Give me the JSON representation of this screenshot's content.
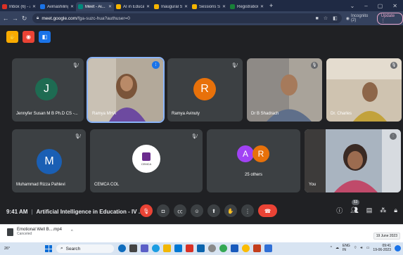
{
  "browser": {
    "tabs": [
      {
        "title": "Inbox (6) - aa...",
        "color": "#d93025",
        "active": false
      },
      {
        "title": "Avinashilingam",
        "color": "#1a73e8",
        "active": false
      },
      {
        "title": "Meet - Ai...",
        "color": "#00897b",
        "active": true
      },
      {
        "title": "AI in Education",
        "color": "#f4b400",
        "active": false
      },
      {
        "title": "Inaugural Sess",
        "color": "#f4b400",
        "active": false
      },
      {
        "title": "Sessions Slide",
        "color": "#f4b400",
        "active": false
      },
      {
        "title": "Registration fo",
        "color": "#188038",
        "active": false
      }
    ],
    "new_tab": "+",
    "url_host": "meet.google.com",
    "url_path": "/fga-suzc-hua?authuser=0",
    "incognito_label": "Incognito (2)",
    "update_label": "Update"
  },
  "meet": {
    "tiles": [
      {
        "name": "Jennyfer Susan M B Ph.D CS -...",
        "initial": "J",
        "avatar_color": "#1e6b52",
        "muted": true
      },
      {
        "name": "Ramya MHA",
        "photo": true,
        "speaking": true
      },
      {
        "name": "Ramya Avinuty",
        "initial": "R",
        "avatar_color": "#e8710a",
        "muted": true
      },
      {
        "name": "Dr B Shadrach",
        "photo": true
      },
      {
        "name": "Dr. Charles",
        "photo": true
      },
      {
        "name": "Muhammad Rizza Pahlevi",
        "initial": "M",
        "avatar_color": "#1a5fb4",
        "muted": true
      },
      {
        "name": "CEMCA COL",
        "logo": "CEMCA",
        "muted": true
      },
      {
        "name": "25 others",
        "initials": [
          "A",
          "R"
        ],
        "colors": [
          "#a142f4",
          "#e8710a"
        ]
      },
      {
        "name": "You",
        "photo": true
      }
    ],
    "time": "9:41 AM",
    "title": "Artificial Intelligence in Education - IV ...",
    "participants_count": "53"
  },
  "download": {
    "file": "Emotional Well B....mp4",
    "status": "Canceled",
    "tooltip": "19 June 2023"
  },
  "taskbar": {
    "temp": "26°",
    "search": "Search",
    "lang": "ENG",
    "region": "IN",
    "time": "09:41",
    "date": "19-06-2023"
  }
}
